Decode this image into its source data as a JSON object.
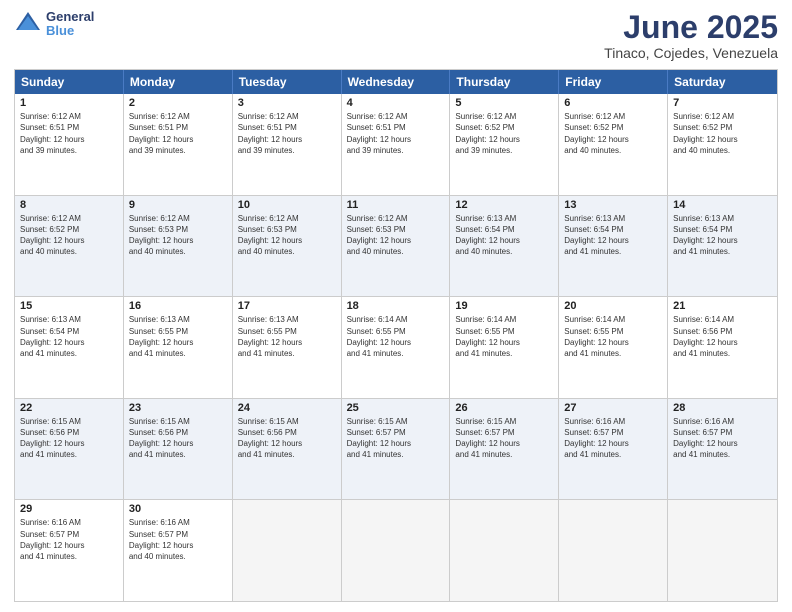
{
  "header": {
    "logo_general": "General",
    "logo_blue": "Blue",
    "month_title": "June 2025",
    "location": "Tinaco, Cojedes, Venezuela"
  },
  "calendar": {
    "days_of_week": [
      "Sunday",
      "Monday",
      "Tuesday",
      "Wednesday",
      "Thursday",
      "Friday",
      "Saturday"
    ],
    "rows": [
      [
        {
          "day": "",
          "empty": true
        },
        {
          "day": "2",
          "line1": "Sunrise: 6:12 AM",
          "line2": "Sunset: 6:51 PM",
          "line3": "Daylight: 12 hours",
          "line4": "and 39 minutes."
        },
        {
          "day": "3",
          "line1": "Sunrise: 6:12 AM",
          "line2": "Sunset: 6:51 PM",
          "line3": "Daylight: 12 hours",
          "line4": "and 39 minutes."
        },
        {
          "day": "4",
          "line1": "Sunrise: 6:12 AM",
          "line2": "Sunset: 6:51 PM",
          "line3": "Daylight: 12 hours",
          "line4": "and 39 minutes."
        },
        {
          "day": "5",
          "line1": "Sunrise: 6:12 AM",
          "line2": "Sunset: 6:52 PM",
          "line3": "Daylight: 12 hours",
          "line4": "and 39 minutes."
        },
        {
          "day": "6",
          "line1": "Sunrise: 6:12 AM",
          "line2": "Sunset: 6:52 PM",
          "line3": "Daylight: 12 hours",
          "line4": "and 40 minutes."
        },
        {
          "day": "7",
          "line1": "Sunrise: 6:12 AM",
          "line2": "Sunset: 6:52 PM",
          "line3": "Daylight: 12 hours",
          "line4": "and 40 minutes."
        }
      ],
      [
        {
          "day": "1",
          "line1": "Sunrise: 6:12 AM",
          "line2": "Sunset: 6:51 PM",
          "line3": "Daylight: 12 hours",
          "line4": "and 39 minutes.",
          "first": true
        },
        {
          "day": "8",
          "line1": "Sunrise: 6:12 AM",
          "line2": "Sunset: 6:52 PM",
          "line3": "Daylight: 12 hours",
          "line4": "and 40 minutes."
        },
        {
          "day": "9",
          "line1": "Sunrise: 6:12 AM",
          "line2": "Sunset: 6:53 PM",
          "line3": "Daylight: 12 hours",
          "line4": "and 40 minutes."
        },
        {
          "day": "10",
          "line1": "Sunrise: 6:12 AM",
          "line2": "Sunset: 6:53 PM",
          "line3": "Daylight: 12 hours",
          "line4": "and 40 minutes."
        },
        {
          "day": "11",
          "line1": "Sunrise: 6:12 AM",
          "line2": "Sunset: 6:53 PM",
          "line3": "Daylight: 12 hours",
          "line4": "and 40 minutes."
        },
        {
          "day": "12",
          "line1": "Sunrise: 6:13 AM",
          "line2": "Sunset: 6:54 PM",
          "line3": "Daylight: 12 hours",
          "line4": "and 40 minutes."
        },
        {
          "day": "13",
          "line1": "Sunrise: 6:13 AM",
          "line2": "Sunset: 6:54 PM",
          "line3": "Daylight: 12 hours",
          "line4": "and 41 minutes."
        },
        {
          "day": "14",
          "line1": "Sunrise: 6:13 AM",
          "line2": "Sunset: 6:54 PM",
          "line3": "Daylight: 12 hours",
          "line4": "and 41 minutes."
        }
      ],
      [
        {
          "day": "15",
          "line1": "Sunrise: 6:13 AM",
          "line2": "Sunset: 6:54 PM",
          "line3": "Daylight: 12 hours",
          "line4": "and 41 minutes."
        },
        {
          "day": "16",
          "line1": "Sunrise: 6:13 AM",
          "line2": "Sunset: 6:55 PM",
          "line3": "Daylight: 12 hours",
          "line4": "and 41 minutes."
        },
        {
          "day": "17",
          "line1": "Sunrise: 6:13 AM",
          "line2": "Sunset: 6:55 PM",
          "line3": "Daylight: 12 hours",
          "line4": "and 41 minutes."
        },
        {
          "day": "18",
          "line1": "Sunrise: 6:14 AM",
          "line2": "Sunset: 6:55 PM",
          "line3": "Daylight: 12 hours",
          "line4": "and 41 minutes."
        },
        {
          "day": "19",
          "line1": "Sunrise: 6:14 AM",
          "line2": "Sunset: 6:55 PM",
          "line3": "Daylight: 12 hours",
          "line4": "and 41 minutes."
        },
        {
          "day": "20",
          "line1": "Sunrise: 6:14 AM",
          "line2": "Sunset: 6:55 PM",
          "line3": "Daylight: 12 hours",
          "line4": "and 41 minutes."
        },
        {
          "day": "21",
          "line1": "Sunrise: 6:14 AM",
          "line2": "Sunset: 6:56 PM",
          "line3": "Daylight: 12 hours",
          "line4": "and 41 minutes."
        }
      ],
      [
        {
          "day": "22",
          "line1": "Sunrise: 6:15 AM",
          "line2": "Sunset: 6:56 PM",
          "line3": "Daylight: 12 hours",
          "line4": "and 41 minutes."
        },
        {
          "day": "23",
          "line1": "Sunrise: 6:15 AM",
          "line2": "Sunset: 6:56 PM",
          "line3": "Daylight: 12 hours",
          "line4": "and 41 minutes."
        },
        {
          "day": "24",
          "line1": "Sunrise: 6:15 AM",
          "line2": "Sunset: 6:56 PM",
          "line3": "Daylight: 12 hours",
          "line4": "and 41 minutes."
        },
        {
          "day": "25",
          "line1": "Sunrise: 6:15 AM",
          "line2": "Sunset: 6:57 PM",
          "line3": "Daylight: 12 hours",
          "line4": "and 41 minutes."
        },
        {
          "day": "26",
          "line1": "Sunrise: 6:15 AM",
          "line2": "Sunset: 6:57 PM",
          "line3": "Daylight: 12 hours",
          "line4": "and 41 minutes."
        },
        {
          "day": "27",
          "line1": "Sunrise: 6:16 AM",
          "line2": "Sunset: 6:57 PM",
          "line3": "Daylight: 12 hours",
          "line4": "and 41 minutes."
        },
        {
          "day": "28",
          "line1": "Sunrise: 6:16 AM",
          "line2": "Sunset: 6:57 PM",
          "line3": "Daylight: 12 hours",
          "line4": "and 41 minutes."
        }
      ],
      [
        {
          "day": "29",
          "line1": "Sunrise: 6:16 AM",
          "line2": "Sunset: 6:57 PM",
          "line3": "Daylight: 12 hours",
          "line4": "and 41 minutes."
        },
        {
          "day": "30",
          "line1": "Sunrise: 6:16 AM",
          "line2": "Sunset: 6:57 PM",
          "line3": "Daylight: 12 hours",
          "line4": "and 40 minutes."
        },
        {
          "day": "",
          "empty": true
        },
        {
          "day": "",
          "empty": true
        },
        {
          "day": "",
          "empty": true
        },
        {
          "day": "",
          "empty": true
        },
        {
          "day": "",
          "empty": true
        }
      ]
    ]
  }
}
